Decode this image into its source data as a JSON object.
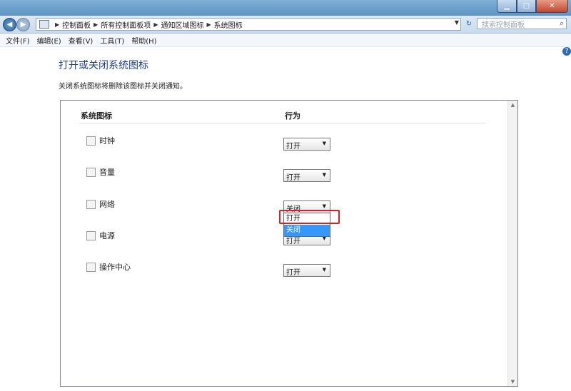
{
  "address": {
    "crumbs": [
      "控制面板",
      "所有控制面板项",
      "通知区域图标",
      "系统图标"
    ],
    "search_placeholder": "搜索控制面板"
  },
  "menu": [
    "文件(F)",
    "编辑(E)",
    "查看(V)",
    "工具(T)",
    "帮助(H)"
  ],
  "page": {
    "title": "打开或关闭系统图标",
    "description": "关闭系统图标将删除该图标并关闭通知。"
  },
  "table": {
    "col_icons": "系统图标",
    "col_behavior": "行为",
    "rows": [
      {
        "icon": "clock-icon",
        "label": "时钟",
        "value": "打开"
      },
      {
        "icon": "volume-icon",
        "label": "音量",
        "value": "打开"
      },
      {
        "icon": "network-icon",
        "label": "网络",
        "value": "关闭"
      },
      {
        "icon": "power-icon",
        "label": "电源",
        "value": "打开"
      },
      {
        "icon": "flag-icon",
        "label": "操作中心",
        "value": "打开"
      }
    ]
  },
  "dropdown_list": {
    "options": [
      "打开",
      "关闭"
    ],
    "selected": "关闭"
  },
  "colors": {
    "title_blue": "#1c3f94",
    "selection": "#3399ff",
    "highlight": "#e02020"
  }
}
